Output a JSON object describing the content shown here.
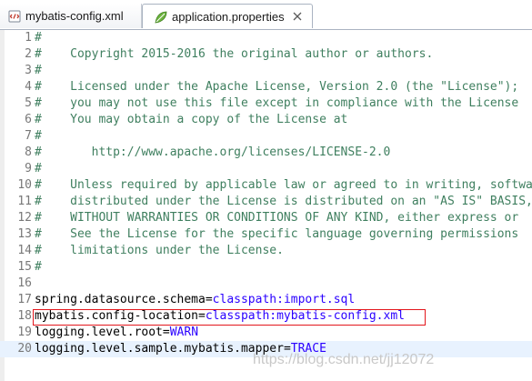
{
  "tabs": [
    {
      "label": "mybatis-config.xml",
      "icon": "xml-file-icon",
      "active": false
    },
    {
      "label": "application.properties",
      "icon": "properties-file-icon",
      "active": true
    }
  ],
  "editor": {
    "current_line": 20,
    "highlighted_line": 18,
    "lines": [
      {
        "num": "1",
        "comment": "#"
      },
      {
        "num": "2",
        "comment": "#    Copyright 2015-2016 the original author or authors."
      },
      {
        "num": "3",
        "comment": "#"
      },
      {
        "num": "4",
        "comment": "#    Licensed under the Apache License, Version 2.0 (the \"License\");"
      },
      {
        "num": "5",
        "comment": "#    you may not use this file except in compliance with the License"
      },
      {
        "num": "6",
        "comment": "#    You may obtain a copy of the License at"
      },
      {
        "num": "7",
        "comment": "#"
      },
      {
        "num": "8",
        "comment": "#       http://www.apache.org/licenses/LICENSE-2.0"
      },
      {
        "num": "9",
        "comment": "#"
      },
      {
        "num": "10",
        "comment": "#    Unless required by applicable law or agreed to in writing, software"
      },
      {
        "num": "11",
        "comment": "#    distributed under the License is distributed on an \"AS IS\" BASIS,"
      },
      {
        "num": "12",
        "comment": "#    WITHOUT WARRANTIES OR CONDITIONS OF ANY KIND, either express or"
      },
      {
        "num": "13",
        "comment": "#    See the License for the specific language governing permissions"
      },
      {
        "num": "14",
        "comment": "#    limitations under the License."
      },
      {
        "num": "15",
        "comment": "#"
      },
      {
        "num": "16",
        "comment": ""
      },
      {
        "num": "17",
        "key": "spring.datasource.schema",
        "eq": "=",
        "value": "classpath:import.sql"
      },
      {
        "num": "18",
        "key": "mybatis.config-location",
        "eq": "=",
        "value": "classpath:mybatis-config.xml"
      },
      {
        "num": "19",
        "key": "logging.level.root",
        "eq": "=",
        "value": "WARN"
      },
      {
        "num": "20",
        "key": "logging.level.sample.mybatis.mapper",
        "eq": "=",
        "value": "TRACE"
      }
    ]
  },
  "watermark": "https://blog.csdn.net/jj12072",
  "colors": {
    "comment": "#3f7f5f",
    "value": "#2a00ff",
    "line_number": "#787878",
    "current_line_bg": "#e8f2fe",
    "highlight_border": "#e3161c"
  }
}
